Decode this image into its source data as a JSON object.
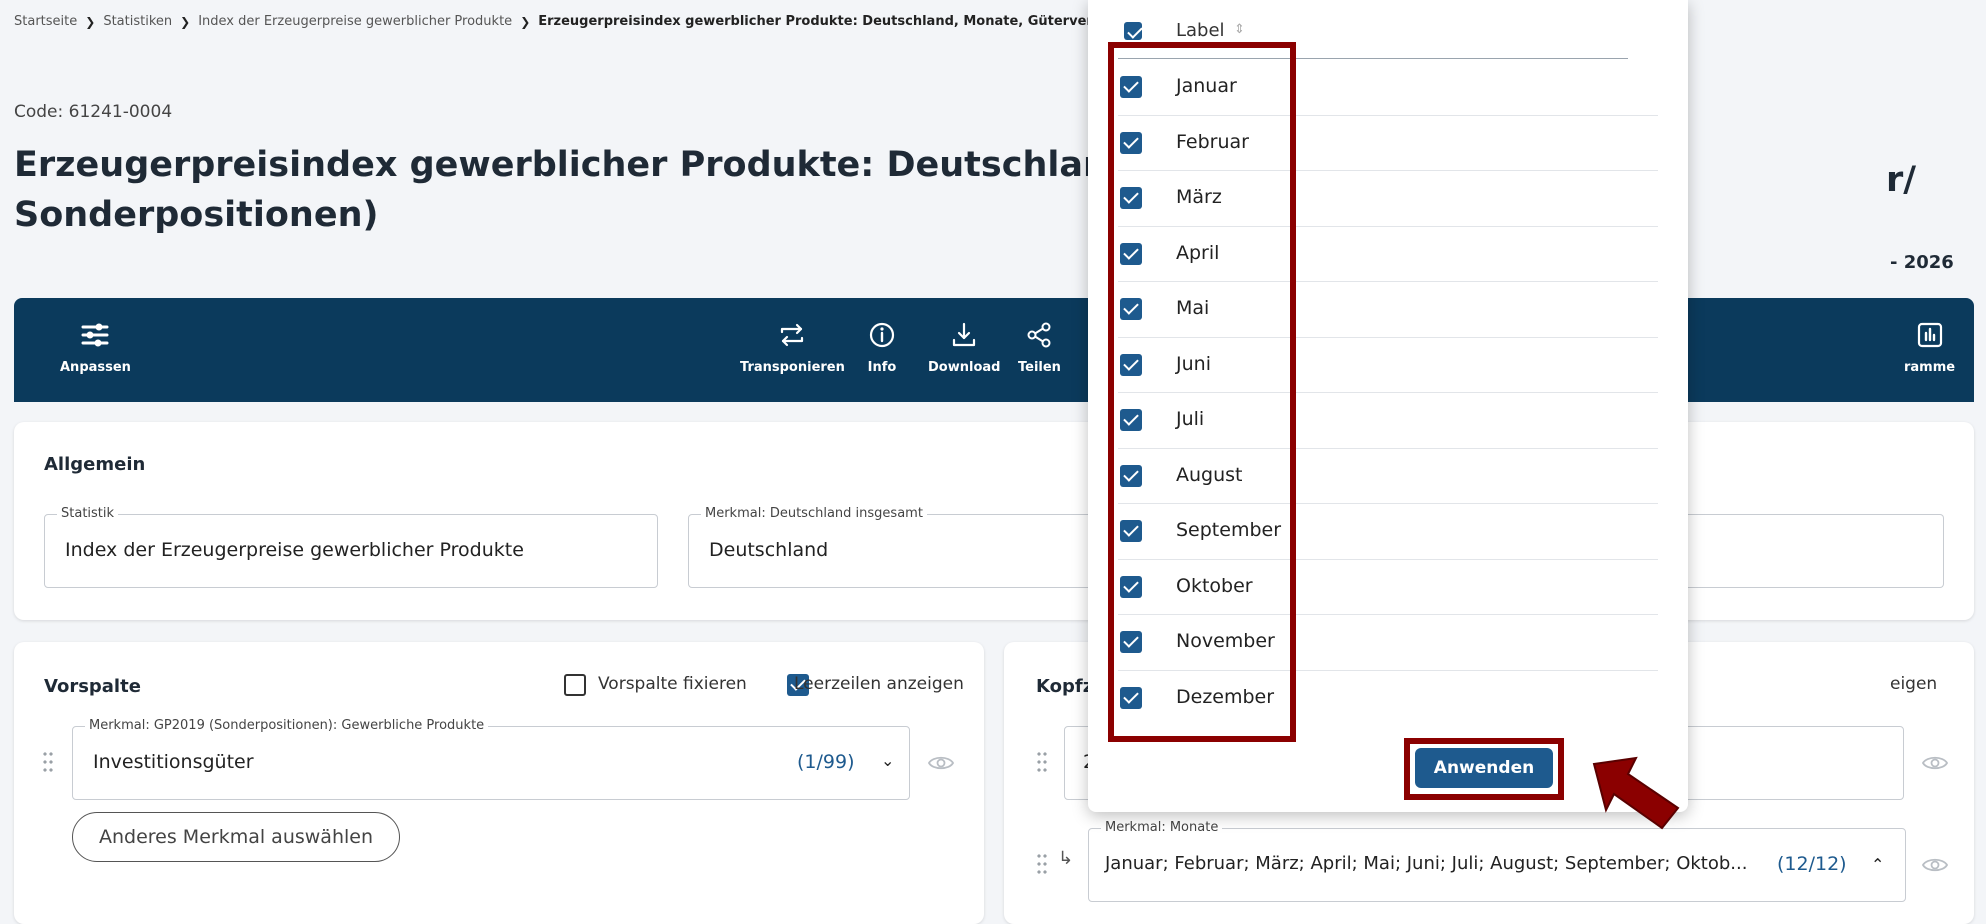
{
  "breadcrumb": {
    "items": [
      "Startseite",
      "Statistiken",
      "Index der Erzeugerpreise gewerblicher Produkte"
    ],
    "current": "Erzeugerpreisindex gewerblicher Produkte: Deutschland, Monate, Güterverz"
  },
  "code": "Code: 61241-0004",
  "title": {
    "line1": "Erzeugerpreisindex gewerblicher Produkte: Deutschland, Monate, (",
    "line2": "Sonderpositionen)",
    "tail": "r/",
    "year_tail": "- 2026"
  },
  "toolbar": {
    "anpassen": "Anpassen",
    "transponieren": "Transponieren",
    "info": "Info",
    "download": "Download",
    "teilen": "Teilen",
    "diagramme_tail": "ramme"
  },
  "allgemein": {
    "title": "Allgemein",
    "statistik_legend": "Statistik",
    "statistik_value": "Index der Erzeugerpreise gewerblicher Produkte",
    "merkmal_legend": "Merkmal: Deutschland insgesamt",
    "merkmal_value": "Deutschland"
  },
  "vorspalte": {
    "title": "Vorspalte",
    "fixieren_label": "Vorspalte fixieren",
    "leerzeilen_label": "Leerzeilen anzeigen",
    "merkmal_legend": "Merkmal: GP2019 (Sonderpositionen): Gewerbliche Produkte",
    "merkmal_value": "Investitionsgüter",
    "merkmal_count": "(1/99)",
    "other_button": "Anderes Merkmal auswählen"
  },
  "kopfzeile": {
    "title_partial": "Kopfz",
    "right_partial": "eigen",
    "first_field_partial": "2",
    "monate_legend": "Merkmal: Monate",
    "monate_value": "Januar; Februar; März; April; Mai; Juni; Juli; August; September; Oktob...",
    "monate_count": "(12/12)"
  },
  "popup": {
    "header_label": "Label",
    "sort_icon": "⇕",
    "months": [
      "Januar",
      "Februar",
      "März",
      "April",
      "Mai",
      "Juni",
      "Juli",
      "August",
      "September",
      "Oktober",
      "November",
      "Dezember"
    ],
    "apply_label": "Anwenden"
  },
  "colors": {
    "toolbar": "#0b3a5c",
    "accent": "#1e5a8e",
    "highlight": "#8b0000"
  }
}
